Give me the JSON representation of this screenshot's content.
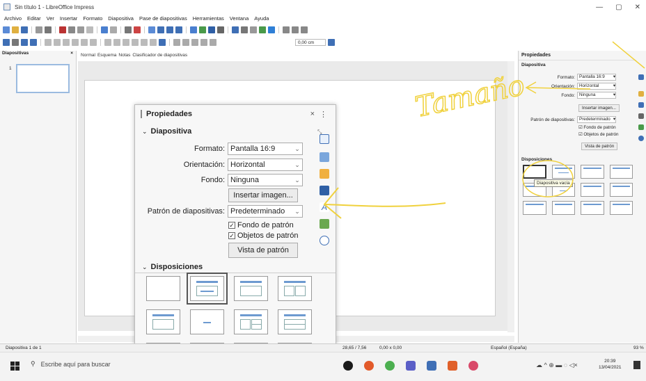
{
  "window": {
    "title": "Sin título 1 - LibreOffice Impress",
    "min": "—",
    "max": "▢",
    "close": "✕"
  },
  "menu": [
    "Archivo",
    "Editar",
    "Ver",
    "Insertar",
    "Formato",
    "Diapositiva",
    "Pase de diapositivas",
    "Herramientas",
    "Ventana",
    "Ayuda"
  ],
  "toolbar2": {
    "measure_value": "0,00 cm"
  },
  "slides_pane": {
    "title": "Diapositivas",
    "close": "×",
    "slide_number": "1"
  },
  "view_tabs": [
    "Normal",
    "Esquema",
    "Notas",
    "Clasificador de diapositivas"
  ],
  "sidebar": {
    "title": "Propiedades",
    "section_slide": "Diapositiva",
    "format_label": "Formato:",
    "format_value": "Pantalla 16:9",
    "orientation_label": "Orientación:",
    "orientation_value": "Horizontal",
    "background_label": "Fondo:",
    "background_value": "Ninguna",
    "insert_image": "Insertar imagen...",
    "master_label": "Patrón de diapositivas:",
    "master_value": "Predeterminado",
    "check_master_bg": "Fondo de patrón",
    "check_master_obj": "Objetos de patrón",
    "master_view": "Vista de patrón",
    "section_layouts": "Disposiciones",
    "tooltip": "Diapositiva vacía"
  },
  "popup": {
    "title": "Propiedades",
    "close": "×",
    "more": "⋮",
    "section_slide": "Diapositiva",
    "format_label": "Formato:",
    "format_value": "Pantalla 16:9",
    "orientation_label": "Orientación:",
    "orientation_value": "Horizontal",
    "background_label": "Fondo:",
    "background_value": "Ninguna",
    "insert_image": "Insertar imagen...",
    "master_label": "Patrón de diapositivas:",
    "master_value": "Predeterminado",
    "check_master_bg": "Fondo de patrón",
    "check_master_obj": "Objetos de patrón",
    "master_view": "Vista de patrón",
    "section_layouts": "Disposiciones"
  },
  "status": {
    "slide": "Diapositiva 1 de 1",
    "position": "28,65 / 7,56",
    "size": "0,00 x 0,00",
    "language": "Español (España)",
    "zoom": "93 %"
  },
  "taskbar": {
    "search_placeholder": "Escribe aquí para buscar",
    "time": "20:39",
    "date": "13/04/2021"
  },
  "annotation": {
    "handwritten": "Tamaño"
  },
  "colors": {
    "accent": "#6d9ad0",
    "ink": "#f0d13c"
  }
}
